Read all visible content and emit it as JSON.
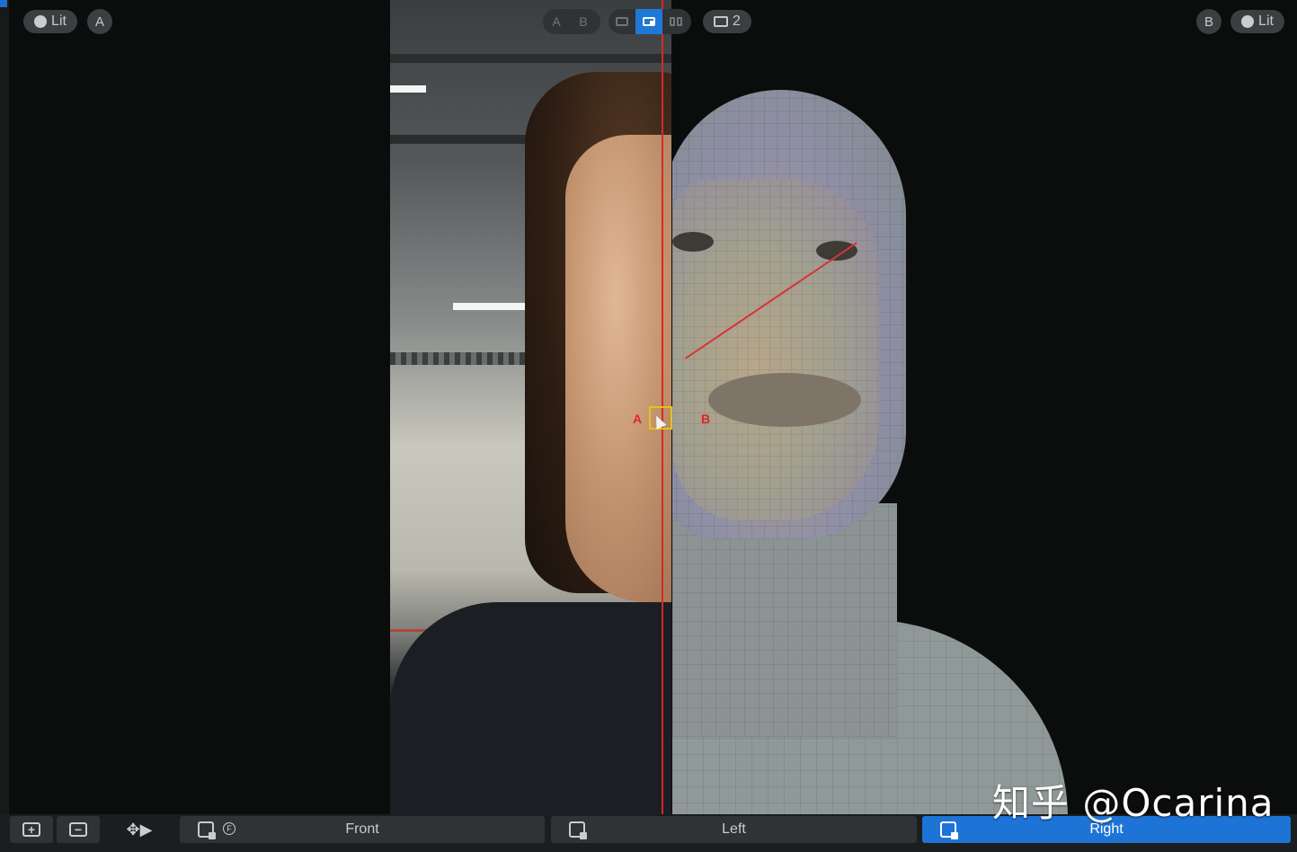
{
  "viewport_a": {
    "lit_label": "Lit",
    "slot_label": "A"
  },
  "viewport_b": {
    "slot_label": "B",
    "lit_label": "Lit"
  },
  "view_toggle": {
    "a_label": "A",
    "b_label": "B"
  },
  "layout_modes": [
    "single",
    "wipe",
    "side-by-side"
  ],
  "active_layout": "wipe",
  "frame_count_label": "2",
  "markers": {
    "a_label": "A",
    "b_label": "B"
  },
  "bottom_bar": {
    "add_icon": "plus-square-icon",
    "remove_icon": "minus-square-icon",
    "camera_icon": "camera-move-icon",
    "views": [
      {
        "label": "Front",
        "active": false
      },
      {
        "label": "Left",
        "active": false
      },
      {
        "label": "Right",
        "active": true
      }
    ]
  },
  "watermark": "知乎 @Ocarina",
  "colors": {
    "accent": "#1f78d6",
    "split_line": "#d5292a",
    "marker_box": "#e3c21e"
  }
}
